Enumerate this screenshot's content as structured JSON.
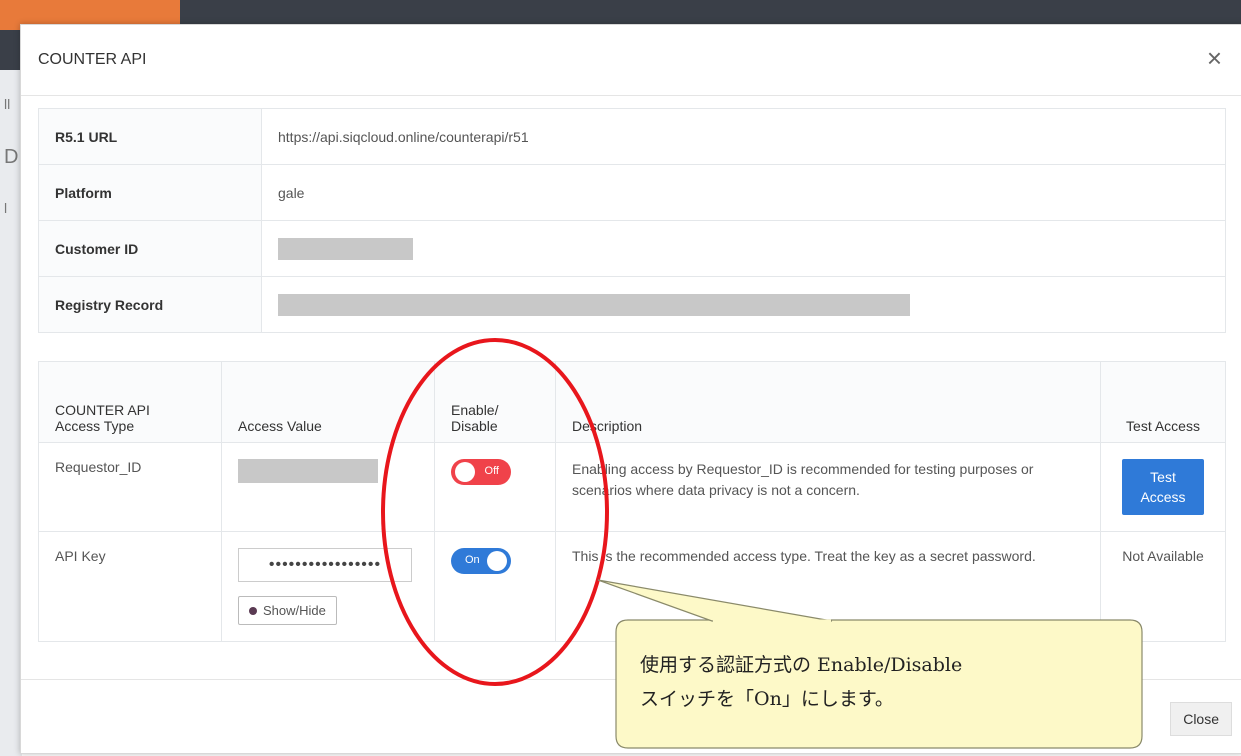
{
  "background": {
    "left_fragments": [
      "ll",
      "D",
      "l"
    ]
  },
  "modal": {
    "title": "COUNTER API",
    "close_icon": "×",
    "info_rows": [
      {
        "label": "R5.1 URL",
        "value": "https://api.siqcloud.online/counterapi/r51"
      },
      {
        "label": "Platform",
        "value": "gale"
      },
      {
        "label": "Customer ID",
        "value": ""
      },
      {
        "label": "Registry Record",
        "value": ""
      }
    ],
    "access_table": {
      "headers": [
        "COUNTER API\nAccess Type",
        "Access Value",
        "Enable/\nDisable",
        "Description",
        "Test Access"
      ],
      "rows": [
        {
          "type": "Requestor_ID",
          "toggle": "Off",
          "enabled": false,
          "description": "Enabling access by Requestor_ID is recommended for testing purposes or scenarios where data privacy is not a concern.",
          "test": "Test Access"
        },
        {
          "type": "API Key",
          "value": "•••••••••••••••••",
          "show_hide": "Show/Hide",
          "toggle": "On",
          "enabled": true,
          "description": "This is the recommended access type. Treat the key as a secret password.",
          "test": "Not Available"
        }
      ]
    },
    "footer": {
      "close": "Close"
    }
  },
  "annotation": {
    "line1": "使用する認証方式の Enable/Disable",
    "line2": "スイッチを「On」にします。",
    "ellipse_color": "#e8161c",
    "callout_fill": "#fdf9c8"
  },
  "colors": {
    "primary": "#2f7ad8",
    "danger": "#f0424a"
  }
}
